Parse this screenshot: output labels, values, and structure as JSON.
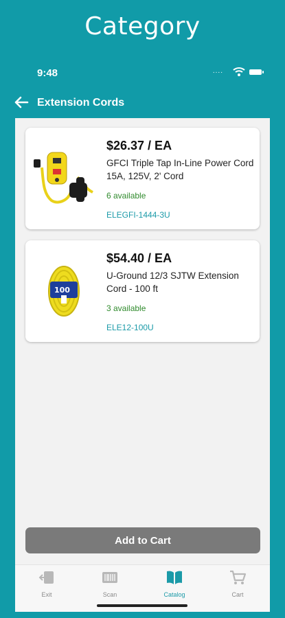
{
  "header": {
    "title": "Category"
  },
  "status": {
    "time": "9:48",
    "dots": "...."
  },
  "nav": {
    "title": "Extension Cords"
  },
  "products": [
    {
      "price": "$26.37 / EA",
      "name": "GFCI Triple Tap In-Line Power Cord 15A, 125V, 2' Cord",
      "availability": "6 available",
      "sku": "ELEGFI-1444-3U"
    },
    {
      "price": "$54.40 / EA",
      "name": "U-Ground 12/3 SJTW Extension Cord - 100 ft",
      "availability": "3 available",
      "sku": "ELE12-100U"
    }
  ],
  "actions": {
    "add_to_cart": "Add to Cart"
  },
  "tabs": [
    {
      "label": "Exit",
      "icon": "exit-icon"
    },
    {
      "label": "Scan",
      "icon": "barcode-icon"
    },
    {
      "label": "Catalog",
      "icon": "book-icon"
    },
    {
      "label": "Cart",
      "icon": "cart-icon"
    }
  ],
  "colors": {
    "accent": "#119ba8",
    "available": "#2f8a2c",
    "button": "#7a7a7a"
  }
}
